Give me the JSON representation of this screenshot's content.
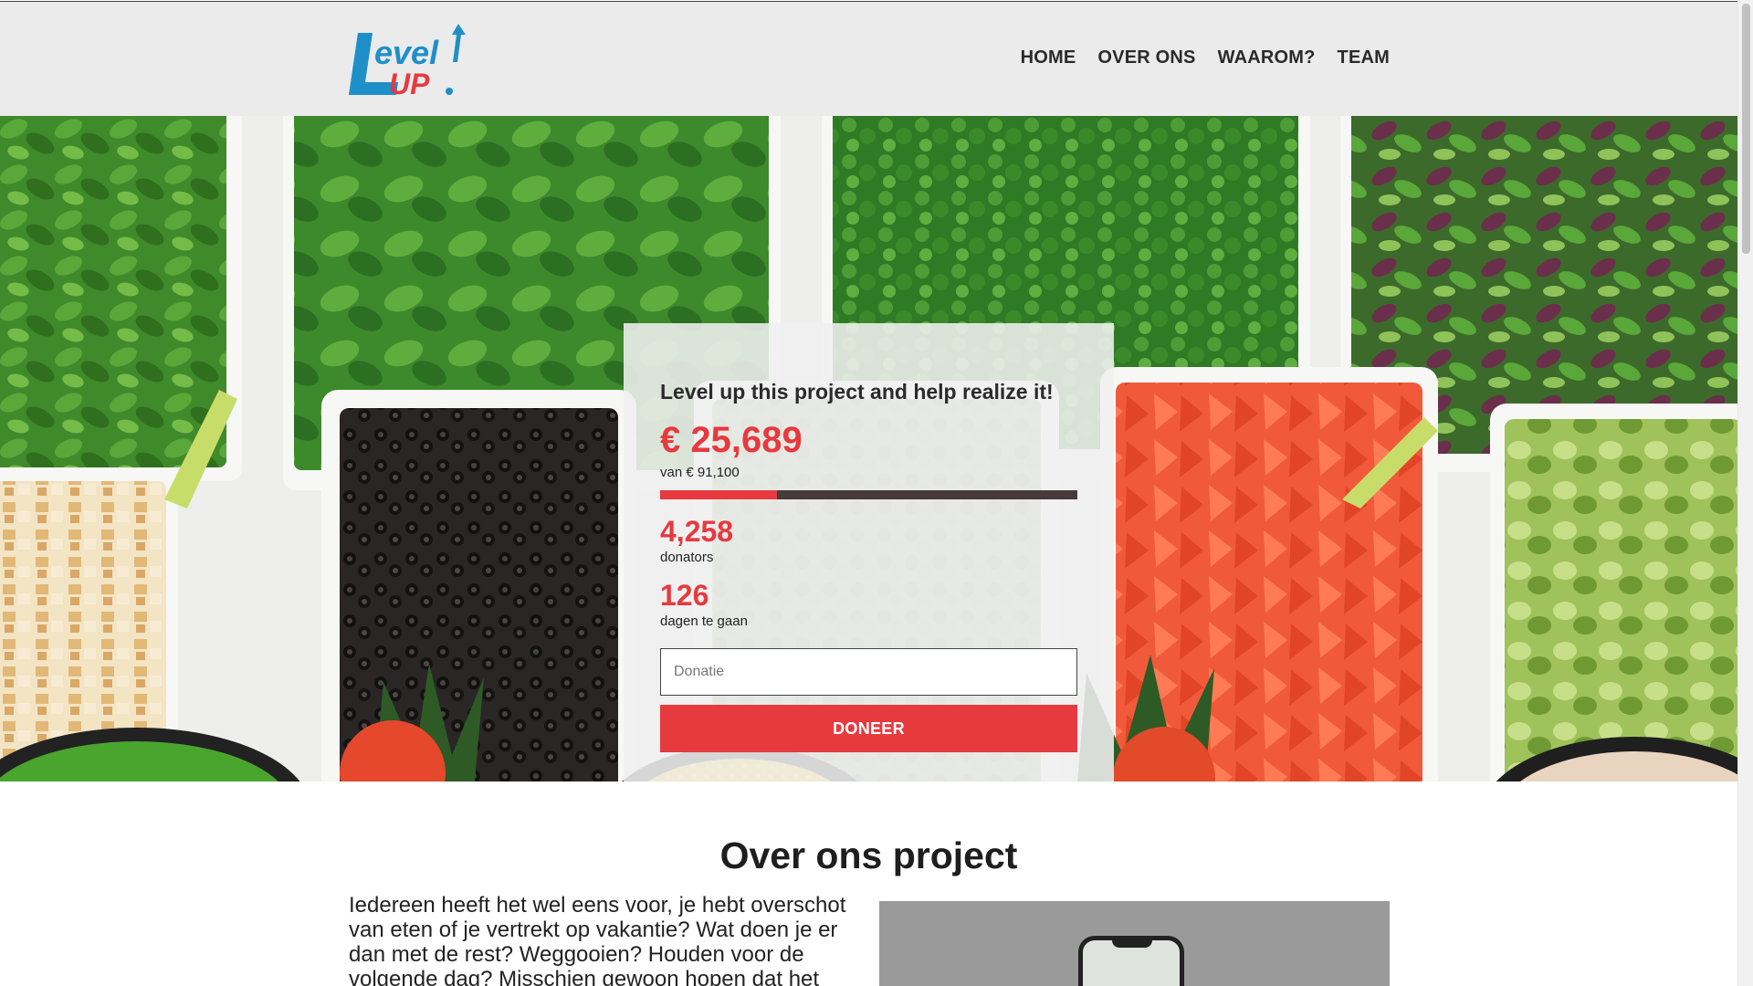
{
  "brand": {
    "logo_alt": "Level UP.",
    "colors": {
      "primary_blue": "#1f8fc9",
      "accent_red": "#e63a3f",
      "track_dark": "#463a3b"
    }
  },
  "nav": {
    "items": [
      {
        "label": "HOME"
      },
      {
        "label": "OVER ONS"
      },
      {
        "label": "WAAROM?"
      },
      {
        "label": "TEAM"
      }
    ]
  },
  "donation": {
    "title": "Level up this project and help realize it!",
    "raised": "€ 25,689",
    "goal": "van € 91,100",
    "progress_fraction": 0.28,
    "donors_count": "4,258",
    "donors_label": "donators",
    "days_count": "126",
    "days_label": "dagen te gaan",
    "input_placeholder": "Donatie",
    "button_label": "DONEER"
  },
  "about": {
    "title": "Over ons project",
    "text": "Iedereen heeft het wel eens voor, je hebt overschot van eten of je vertrekt op vakantie? Wat doen je er dan met de rest? Weggooien? Houden voor de volgende dag? Misschien gewoon hopen dat het niet"
  }
}
